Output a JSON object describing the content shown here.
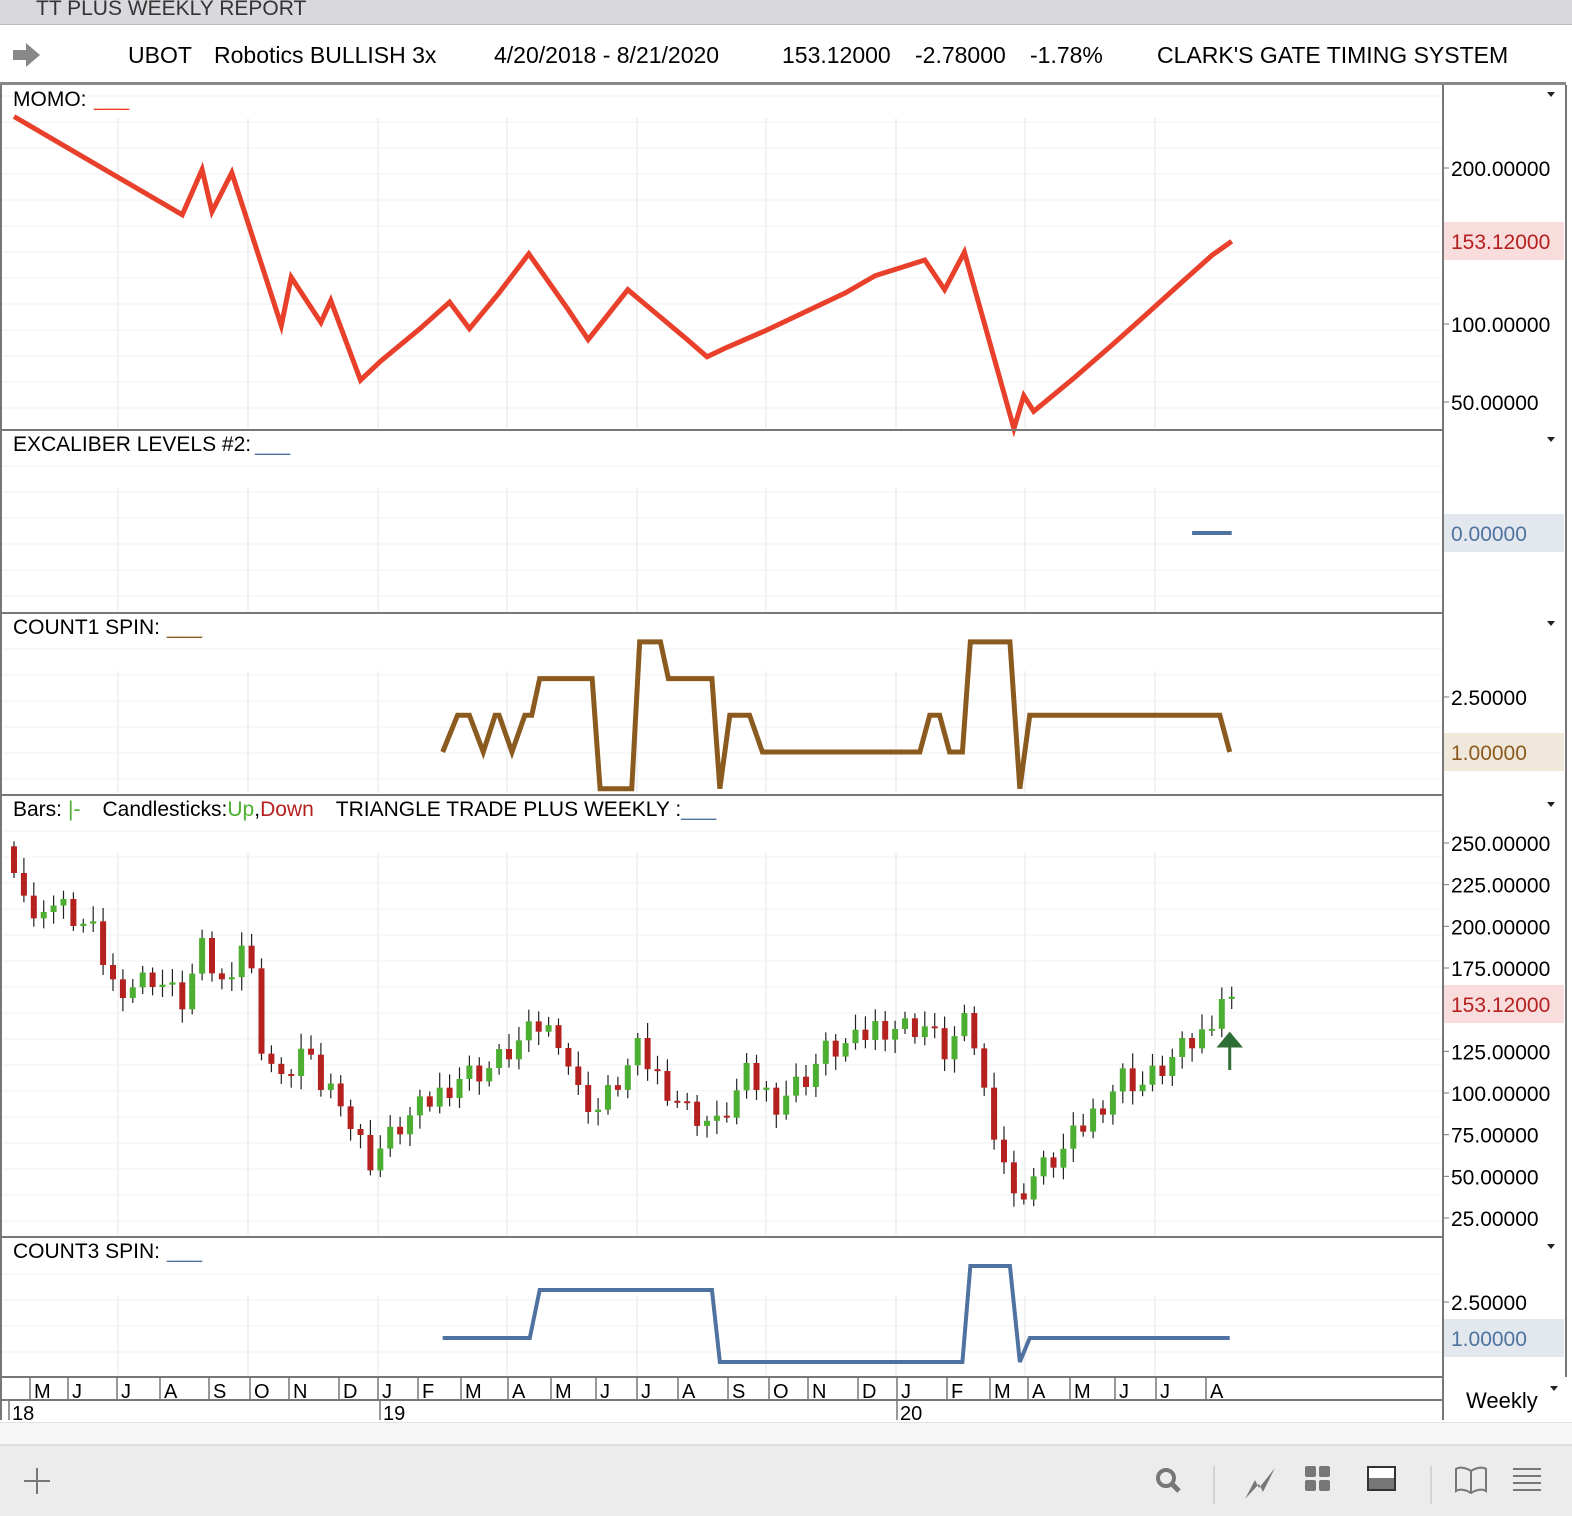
{
  "window_title": "TT PLUS WEEKLY REPORT",
  "header": {
    "symbol": "UBOT",
    "name": "Robotics BULLISH 3x",
    "date_range": "4/20/2018 - 8/21/2020",
    "last": "153.12000",
    "change": "-2.78000",
    "change_pct": "-1.78%",
    "system": "CLARK'S GATE TIMING SYSTEM"
  },
  "colors": {
    "momo": "#e8402a",
    "excal": "#4f72a0",
    "count1": "#8b5a1e",
    "count3": "#4f72a0",
    "up": "#4caf32",
    "down": "#b5211f",
    "arrow": "#2f6e36"
  },
  "panels": {
    "momo": {
      "label": "MOMO:",
      "legend": "___",
      "ticks": [
        "200.00000",
        "100.00000",
        "50.00000"
      ],
      "current": "153.12000"
    },
    "excal": {
      "label": "EXCALIBER LEVELS #2:",
      "legend": "___",
      "current": "0.00000"
    },
    "count1": {
      "label": "COUNT1 SPIN:",
      "legend": "___",
      "ticks": [
        "2.50000"
      ],
      "current": "1.00000"
    },
    "bars": {
      "bars_label": "Bars:",
      "bars_legend": "|-",
      "candles_label": "Candlesticks:",
      "up": "Up",
      "comma": ",",
      "down": "Down",
      "ttp_label": "TRIANGLE TRADE PLUS WEEKLY :",
      "ttp_legend": "___",
      "ticks": [
        "250.00000",
        "225.00000",
        "200.00000",
        "175.00000",
        "125.00000",
        "100.00000",
        "75.00000",
        "50.00000",
        "25.00000"
      ],
      "current": "153.12000"
    },
    "count3": {
      "label": "COUNT3 SPIN:",
      "legend": "___",
      "ticks": [
        "2.50000"
      ],
      "current": "1.00000"
    }
  },
  "time_axis": {
    "months": [
      "M",
      "J",
      "J",
      "A",
      "S",
      "O",
      "N",
      "D",
      "J",
      "F",
      "M",
      "A",
      "M",
      "J",
      "J",
      "A",
      "S",
      "O",
      "N",
      "D",
      "J",
      "F",
      "M",
      "A",
      "M",
      "J",
      "J",
      "A"
    ],
    "years": [
      "18",
      "19",
      "20"
    ],
    "period": "Weekly"
  },
  "toolbar": [
    "add",
    "search",
    "draw",
    "layout",
    "panel",
    "book",
    "menu"
  ],
  "chart_data": [
    {
      "type": "line",
      "title": "MOMO",
      "x_unit": "week",
      "ylim": [
        30,
        240
      ],
      "points": [
        [
          0,
          233
        ],
        [
          17,
          170
        ],
        [
          19,
          199
        ],
        [
          20,
          172
        ],
        [
          22,
          197
        ],
        [
          27,
          99
        ],
        [
          28,
          130
        ],
        [
          31,
          101
        ],
        [
          32,
          115
        ],
        [
          35,
          64
        ],
        [
          37,
          76
        ],
        [
          41,
          97
        ],
        [
          44,
          114
        ],
        [
          46,
          97
        ],
        [
          49,
          120
        ],
        [
          52,
          145
        ],
        [
          56,
          109
        ],
        [
          58,
          90
        ],
        [
          62,
          122
        ],
        [
          65,
          106
        ],
        [
          68,
          90
        ],
        [
          70,
          79
        ],
        [
          72,
          85
        ],
        [
          76,
          96
        ],
        [
          80,
          108
        ],
        [
          84,
          120
        ],
        [
          87,
          131
        ],
        [
          92,
          141
        ],
        [
          94,
          122
        ],
        [
          96,
          146
        ],
        [
          101,
          33
        ],
        [
          102,
          54
        ],
        [
          103,
          44
        ],
        [
          107,
          65
        ],
        [
          111,
          87
        ],
        [
          114,
          104
        ],
        [
          118,
          127
        ],
        [
          121,
          144
        ],
        [
          123,
          153
        ]
      ]
    },
    {
      "type": "line",
      "title": "EXCALIBER LEVELS #2",
      "points": [
        [
          119,
          0
        ],
        [
          123,
          0
        ]
      ]
    },
    {
      "type": "line",
      "title": "COUNT1 SPIN",
      "ylim": [
        0,
        4
      ],
      "points": [
        [
          43.3,
          1
        ],
        [
          44.8,
          2
        ],
        [
          46,
          2
        ],
        [
          47.4,
          1
        ],
        [
          48.6,
          2
        ],
        [
          49,
          2
        ],
        [
          50.3,
          1
        ],
        [
          51.6,
          2
        ],
        [
          52.3,
          2
        ],
        [
          53.1,
          3
        ],
        [
          58.4,
          3
        ],
        [
          59.2,
          0
        ],
        [
          62.4,
          0
        ],
        [
          63.2,
          4
        ],
        [
          65.3,
          4
        ],
        [
          66.1,
          3
        ],
        [
          70.5,
          3
        ],
        [
          71.3,
          0
        ],
        [
          72.3,
          2
        ],
        [
          74.3,
          2
        ],
        [
          75.6,
          1
        ],
        [
          91.5,
          1
        ],
        [
          92.5,
          2
        ],
        [
          93.5,
          2
        ],
        [
          94.5,
          1
        ],
        [
          95.8,
          1
        ],
        [
          96.6,
          4
        ],
        [
          100.6,
          4
        ],
        [
          101.6,
          0
        ],
        [
          102.6,
          2
        ],
        [
          121.8,
          2
        ],
        [
          122.8,
          1
        ]
      ]
    },
    {
      "type": "candlestick",
      "title": "UBOT weekly",
      "ylim": [
        20,
        260
      ],
      "close_keypoints": [
        [
          0,
          240
        ],
        [
          2,
          200
        ],
        [
          3,
          215
        ],
        [
          5,
          210
        ],
        [
          8,
          195
        ],
        [
          10,
          165
        ],
        [
          12,
          165
        ],
        [
          14,
          170
        ],
        [
          17,
          155
        ],
        [
          19,
          185
        ],
        [
          21,
          165
        ],
        [
          23,
          190
        ],
        [
          24,
          170
        ],
        [
          25,
          130
        ],
        [
          27,
          105
        ],
        [
          29,
          125
        ],
        [
          31,
          105
        ],
        [
          33,
          100
        ],
        [
          34,
          80
        ],
        [
          36,
          60
        ],
        [
          39,
          80
        ],
        [
          42,
          95
        ],
        [
          45,
          110
        ],
        [
          48,
          115
        ],
        [
          51,
          130
        ],
        [
          53,
          140
        ],
        [
          55,
          135
        ],
        [
          57,
          100
        ],
        [
          59,
          90
        ],
        [
          62,
          115
        ],
        [
          63,
          125
        ],
        [
          65,
          110
        ],
        [
          68,
          90
        ],
        [
          71,
          80
        ],
        [
          74,
          110
        ],
        [
          77,
          95
        ],
        [
          80,
          110
        ],
        [
          82,
          125
        ],
        [
          85,
          130
        ],
        [
          87,
          140
        ],
        [
          92,
          140
        ],
        [
          94,
          125
        ],
        [
          96,
          140
        ],
        [
          97,
          130
        ],
        [
          98,
          100
        ],
        [
          100,
          60
        ],
        [
          101,
          35
        ],
        [
          103,
          50
        ],
        [
          106,
          65
        ],
        [
          108,
          80
        ],
        [
          110,
          95
        ],
        [
          112,
          110
        ],
        [
          114,
          105
        ],
        [
          117,
          120
        ],
        [
          120,
          135
        ],
        [
          122,
          158
        ],
        [
          123,
          153
        ]
      ],
      "signal": "up-arrow at last bar"
    },
    {
      "type": "line",
      "title": "COUNT3 SPIN",
      "ylim": [
        0,
        4
      ],
      "points": [
        [
          43.3,
          1
        ],
        [
          52.1,
          1
        ],
        [
          53.1,
          3
        ],
        [
          70.5,
          3
        ],
        [
          71.3,
          0
        ],
        [
          95.8,
          0
        ],
        [
          96.6,
          4
        ],
        [
          100.6,
          4
        ],
        [
          101.6,
          0
        ],
        [
          102.6,
          1
        ],
        [
          122.8,
          1
        ]
      ]
    }
  ]
}
